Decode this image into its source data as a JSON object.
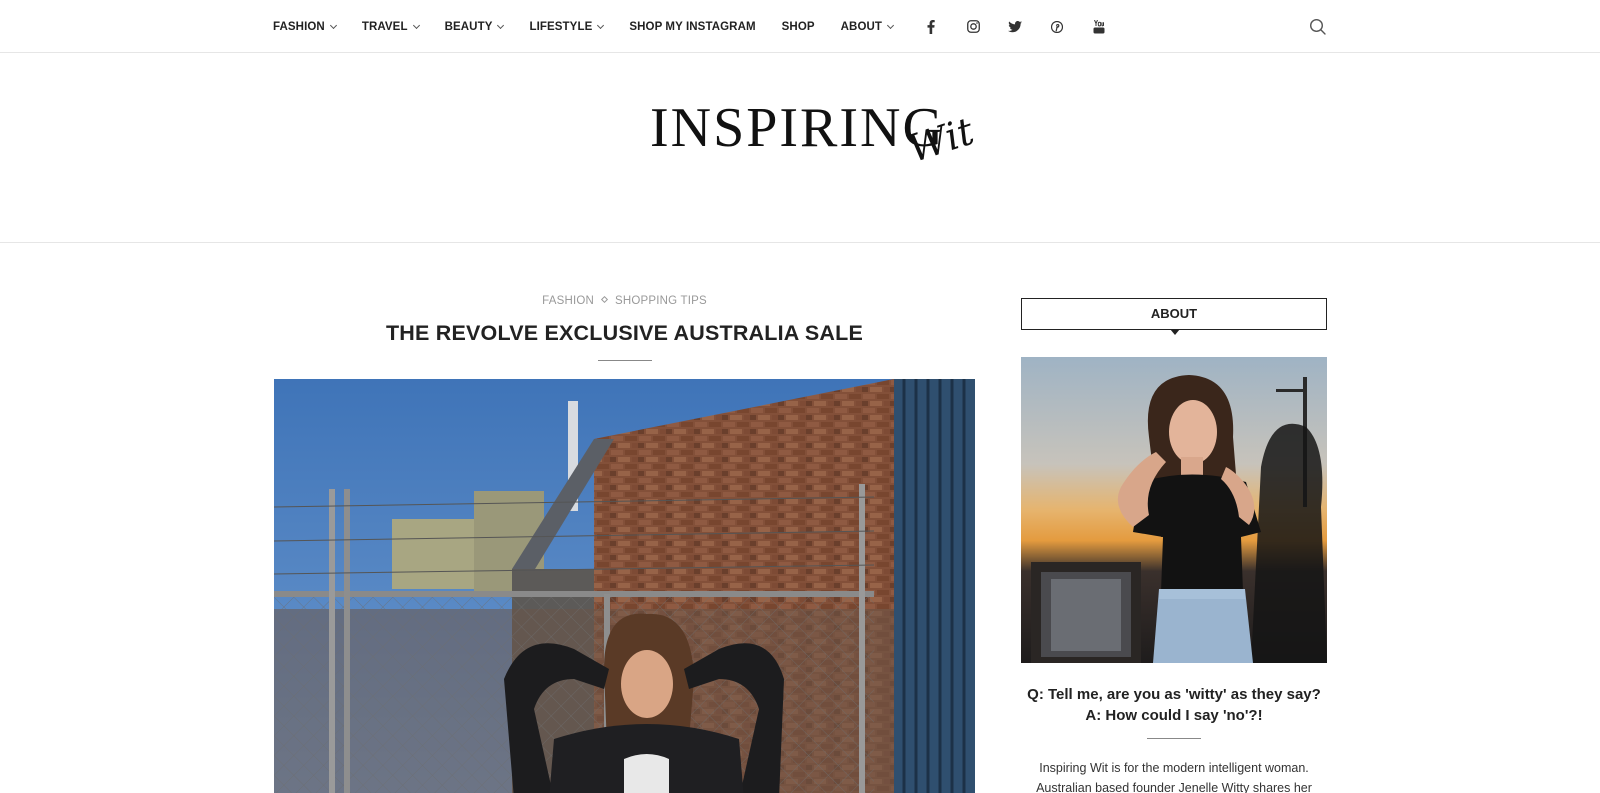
{
  "nav": {
    "items": [
      {
        "label": "FASHION",
        "dropdown": true
      },
      {
        "label": "TRAVEL",
        "dropdown": true
      },
      {
        "label": "BEAUTY",
        "dropdown": true
      },
      {
        "label": "LIFESTYLE",
        "dropdown": true
      },
      {
        "label": "SHOP MY INSTAGRAM",
        "dropdown": false
      },
      {
        "label": "SHOP",
        "dropdown": false
      },
      {
        "label": "ABOUT",
        "dropdown": true
      }
    ],
    "social_icons": [
      "facebook-icon",
      "instagram-icon",
      "twitter-icon",
      "pinterest-icon",
      "youtube-icon"
    ],
    "search_icon": "search-icon"
  },
  "logo": {
    "main": "INSPIRING",
    "script": "Wit"
  },
  "article": {
    "categories": [
      "FASHION",
      "SHOPPING TIPS"
    ],
    "title": "THE REVOLVE EXCLUSIVE AUSTRALIA SALE"
  },
  "sidebar": {
    "widget_title": "ABOUT",
    "question": "Q: Tell me, are you as 'witty' as they say?",
    "answer": "A: How could I say 'no'?!",
    "text_line1": "Inspiring Wit is for the modern intelligent woman.",
    "text_line2": "Australian based founder Jenelle Witty shares her"
  },
  "colors": {
    "text": "#222222",
    "muted": "#999999",
    "border": "#e6e6e6"
  }
}
